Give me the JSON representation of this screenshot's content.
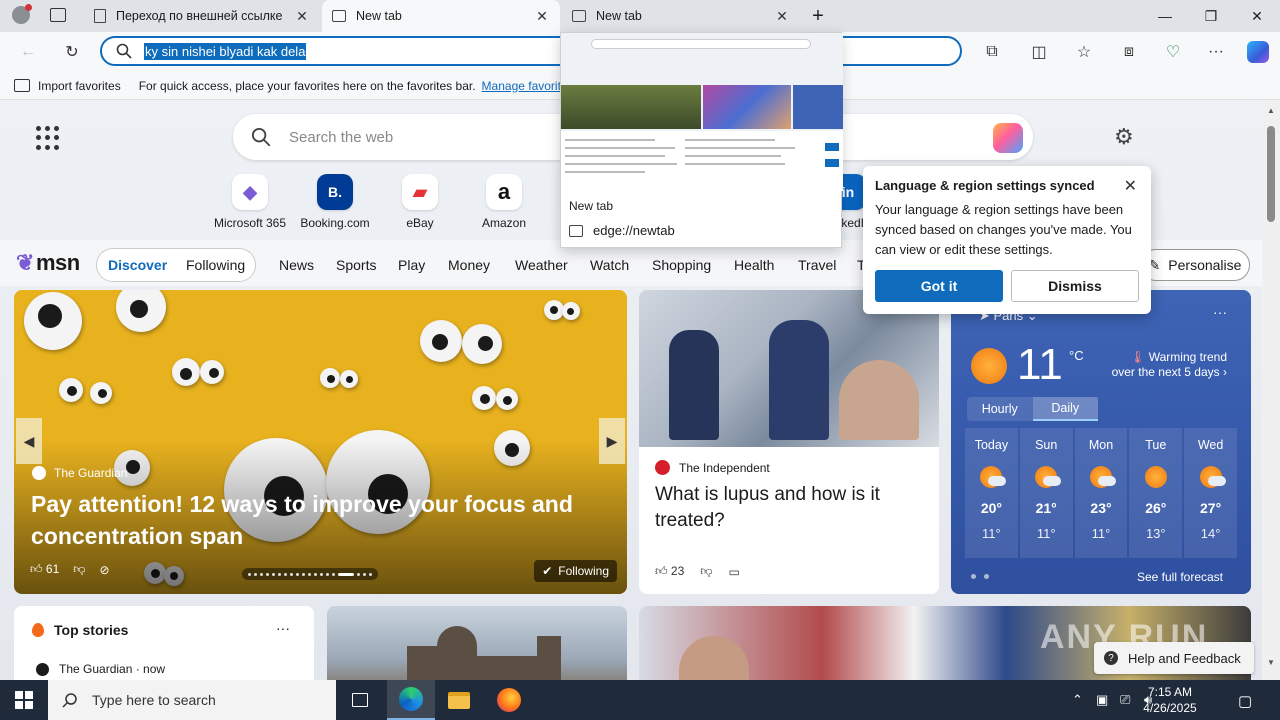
{
  "browser": {
    "tabs": [
      {
        "title": "Переход по внешней ссылке",
        "icon": "page-icon",
        "close": "✕"
      },
      {
        "title": "New tab",
        "icon": "newtab-icon",
        "close": "✕"
      },
      {
        "title": "New tab",
        "icon": "newtab-icon",
        "close": "✕"
      }
    ],
    "new_tab": "+",
    "window_controls": {
      "minimize": "—",
      "maximize": "❐",
      "close": "✕"
    },
    "address": {
      "value": "ky sin nishei blyadi kak dela"
    }
  },
  "favorites_bar": {
    "import_label": "Import favorites",
    "hint": "For quick access, place your favorites here on the favorites bar.",
    "manage_link": "Manage favorites"
  },
  "newtab": {
    "search_placeholder": "Search the web",
    "quick_links": [
      {
        "label": "Microsoft 365",
        "glyph": "◆",
        "color": "#7b5bd6"
      },
      {
        "label": "Booking.com",
        "glyph": "B.",
        "color": "#003b95"
      },
      {
        "label": "eBay",
        "glyph": "▰",
        "color": "#e53238"
      },
      {
        "label": "Amazon",
        "glyph": "a",
        "color": "#111111"
      },
      {
        "label": "LinkedIn",
        "glyph": "in",
        "color": "#0a66c2"
      }
    ]
  },
  "msn": {
    "logo": "msn",
    "pill": [
      "Discover",
      "Following"
    ],
    "nav": [
      "News",
      "Sports",
      "Play",
      "Money",
      "Weather",
      "Watch",
      "Shopping",
      "Health",
      "Travel",
      "T"
    ],
    "personalise": "Personalise"
  },
  "hero": {
    "source": "The Guardian",
    "headline": "Pay attention! 12 ways to improve your focus and concentration span",
    "likes": "61",
    "following": "Following",
    "carousel_count": 19,
    "carousel_active": 15
  },
  "lupus": {
    "source": "The Independent",
    "headline": "What is lupus and how is it treated?",
    "likes": "23"
  },
  "weather": {
    "city": "Paris",
    "more": "···",
    "temp": "11",
    "unit": "°C",
    "trend": "Warming trend over the next 5 days",
    "tabs": [
      "Hourly",
      "Daily"
    ],
    "days": [
      {
        "day": "Today",
        "hi": "20°",
        "lo": "11°",
        "icon": "partly-cloudy"
      },
      {
        "day": "Sun",
        "hi": "21°",
        "lo": "11°",
        "icon": "partly-cloudy"
      },
      {
        "day": "Mon",
        "hi": "23°",
        "lo": "11°",
        "icon": "partly-cloudy"
      },
      {
        "day": "Tue",
        "hi": "26°",
        "lo": "13°",
        "icon": "sunny"
      },
      {
        "day": "Wed",
        "hi": "27°",
        "lo": "14°",
        "icon": "partly-cloudy"
      }
    ],
    "forecast_link": "See full forecast"
  },
  "top_stories": {
    "title": "Top stories",
    "more": "···",
    "source": "The Guardian · now"
  },
  "sync_popup": {
    "title": "Language & region settings synced",
    "body": "Your language & region settings have been synced based on changes you've made. You can view or edit these settings.",
    "primary": "Got it",
    "secondary": "Dismiss"
  },
  "tab_preview": {
    "title": "New tab",
    "url": "edge://newtab"
  },
  "watermark": "ANY RUN",
  "help_button": "Help and Feedback",
  "taskbar": {
    "search_placeholder": "Type here to search",
    "time": "7:15 AM",
    "date": "4/26/2025"
  }
}
